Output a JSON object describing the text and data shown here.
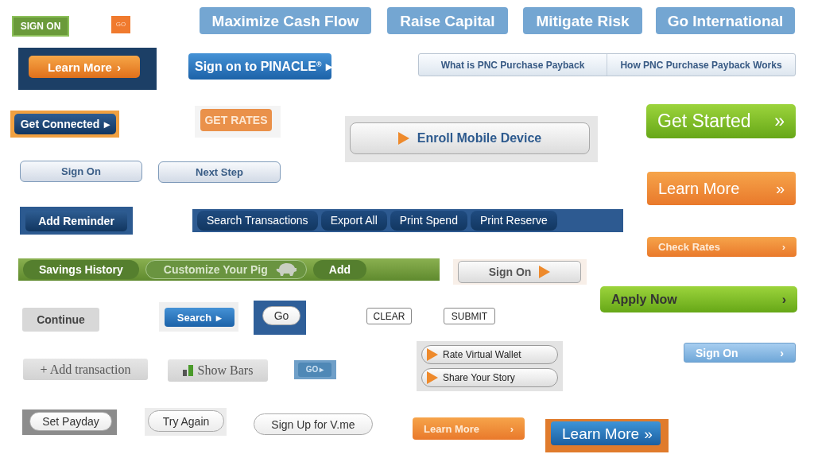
{
  "buttons": [
    {
      "kind": "green-tag",
      "label": "SIGN ON"
    },
    {
      "kind": "orange-tag",
      "label": "GO"
    },
    {
      "kind": "sky-tile",
      "label": "Maximize Cash Flow"
    },
    {
      "kind": "sky-tile",
      "label": "Raise Capital"
    },
    {
      "kind": "sky-tile",
      "label": "Mitigate Risk"
    },
    {
      "kind": "sky-tile",
      "label": "Go International"
    },
    {
      "kind": "orange-gloss",
      "label": "Learn More",
      "suffix": "›",
      "framed": true
    },
    {
      "kind": "blue-gloss",
      "label": "Sign on to PINACLE$^{®}$",
      "suffix": "▸"
    },
    {
      "kind": "tab-strip",
      "items": [
        {
          "label": "What is PNC Purchase Payback"
        },
        {
          "label": "How PNC Purchase Payback Works"
        }
      ]
    },
    {
      "kind": "navy-gloss",
      "label": "Get Connected",
      "suffix": "▸",
      "framed": true
    },
    {
      "kind": "orange-soft",
      "label": "GET RATES",
      "framed": true
    },
    {
      "kind": "gray-gloss",
      "label": "Enroll Mobile Device",
      "framed": true
    },
    {
      "kind": "lime-large",
      "label": "Get Started",
      "suffix": "»"
    },
    {
      "kind": "pale-blue",
      "label": "Sign On"
    },
    {
      "kind": "pale-blue",
      "label": "Next Step"
    },
    {
      "kind": "orange-large",
      "label": "Learn More",
      "suffix": "»"
    },
    {
      "kind": "navy-gloss",
      "label": "Add Reminder",
      "framed": true
    },
    {
      "kind": "navy-bar",
      "items": [
        {
          "label": "Search Transactions"
        },
        {
          "label": "Export All"
        },
        {
          "label": "Print Spend"
        },
        {
          "label": "Print Reserve"
        }
      ]
    },
    {
      "kind": "orange-slim",
      "label": "Check Rates",
      "suffix": "›"
    },
    {
      "kind": "green-bar",
      "items": [
        {
          "kind": "solid",
          "label": "Savings History"
        },
        {
          "kind": "outline",
          "label": "Customize Your Pig"
        },
        {
          "kind": "solid",
          "label": "Add"
        }
      ]
    },
    {
      "kind": "gray-gloss-small",
      "label": "Sign On",
      "framed": true
    },
    {
      "kind": "lime-slim",
      "label": "Apply Now",
      "suffix": "›"
    },
    {
      "kind": "gray-flat",
      "label": "Continue"
    },
    {
      "kind": "blue-gloss-small",
      "label": "Search",
      "suffix": "▸",
      "framed": true
    },
    {
      "kind": "white-pill",
      "label": "Go",
      "framed": true
    },
    {
      "kind": "outline",
      "label": "CLEAR"
    },
    {
      "kind": "outline",
      "label": "SUBMIT"
    },
    {
      "kind": "pill-stack",
      "items": [
        {
          "label": "Rate Virtual Wallet"
        },
        {
          "label": "Share Your Story"
        }
      ]
    },
    {
      "kind": "sky-slim",
      "label": "Sign On",
      "suffix": "›"
    },
    {
      "kind": "gray-serif",
      "label": "+ Add transaction"
    },
    {
      "kind": "bars-serif",
      "label": "Show Bars"
    },
    {
      "kind": "steel-tag",
      "label": "GO",
      "suffix": "▸",
      "framed": true
    },
    {
      "kind": "white-pill",
      "label": "Set Payday",
      "framed": true
    },
    {
      "kind": "white-pill",
      "label": "Try Again",
      "framed": true
    },
    {
      "kind": "white-pill",
      "label": "Sign Up for V.me"
    },
    {
      "kind": "orange-slim",
      "label": "Learn More",
      "suffix": "›"
    },
    {
      "kind": "blue-large",
      "label": "Learn More",
      "suffix": "»",
      "framed": true
    }
  ]
}
